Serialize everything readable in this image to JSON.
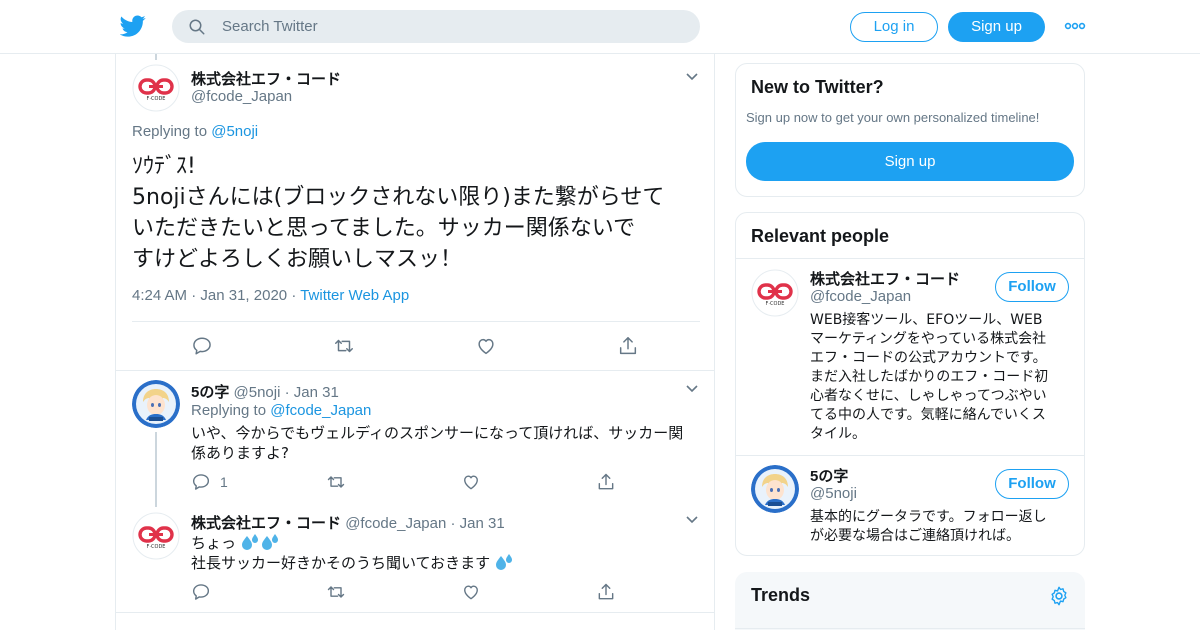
{
  "header": {
    "search_placeholder": "Search Twitter",
    "login_label": "Log in",
    "signup_label": "Sign up",
    "icons": [
      "twitter-bird-icon",
      "search-icon",
      "more-icon"
    ]
  },
  "main_tweet": {
    "name": "株式会社エフ・コード",
    "handle": "@fcode_Japan",
    "replying_prefix": "Replying to",
    "replying_handle": "@5noji",
    "text_lines": [
      "ｿｳﾃﾞｽ!",
      "5nojiさんには(ブロックされない限り)また繋がらせて",
      "いただきたいと思ってました。サッカー関係ないで",
      "すけどよろしくお願いしマスッ！"
    ],
    "time": "4:24 AM",
    "date": "Jan 31, 2020",
    "source": "Twitter Web App"
  },
  "replies": [
    {
      "name": "5の字",
      "handle": "@5noji",
      "date": "Jan 31",
      "replying_prefix": "Replying to",
      "replying_handle": "@fcode_Japan",
      "text_lines": [
        "いや、今からでもヴェルディのスポンサーになって頂ければ、サッカー関",
        "係ありますよ?"
      ],
      "reply_count": "1"
    },
    {
      "name": "株式会社エフ・コード",
      "handle": "@fcode_Japan",
      "date": "Jan 31",
      "text_lines": [
        "ちょっ",
        "社長サッカー好きかそのうち聞いておきます"
      ]
    }
  ],
  "sidebar": {
    "new_title": "New to Twitter?",
    "new_subtitle": "Sign up now to get your own personalized timeline!",
    "new_signup": "Sign up",
    "relevant_title": "Relevant people",
    "people": [
      {
        "name": "株式会社エフ・コード",
        "handle": "@fcode_Japan",
        "follow": "Follow",
        "bio_lines": [
          "WEB接客ツール、EFOツール、WEB",
          "マーケティングをやっている株式会社",
          "エフ・コードの公式アカウントです。",
          "まだ入社したばかりのエフ・コード初",
          "心者なくせに、しゃしゃってつぶやい",
          "てる中の人です。気軽に絡んでいくス",
          "タイル。"
        ]
      },
      {
        "name": "5の字",
        "handle": "@5noji",
        "follow": "Follow",
        "bio_lines": [
          "基本的にグータラです。フォロー返し",
          "が必要な場合はご連絡頂ければ。"
        ]
      }
    ],
    "trends_title": "Trends"
  },
  "colors": {
    "twitter_blue": "#1da1f2",
    "link_blue": "#1b95e0",
    "fcode_red": "#e0324a",
    "muted": "#657786",
    "border": "#e6ecf0"
  }
}
